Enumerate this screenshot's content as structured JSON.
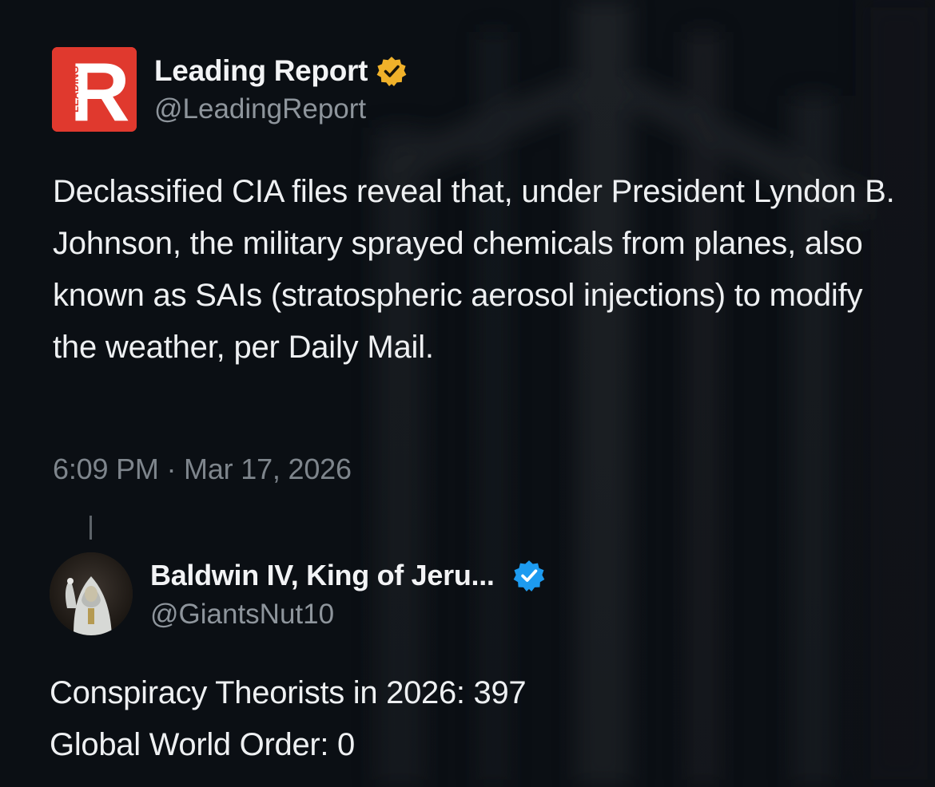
{
  "background": {
    "color": "#0b0f14",
    "description_icon": "blurred-architecture-photo-icon"
  },
  "post": {
    "author": {
      "display_name": "Leading Report",
      "handle": "@LeadingReport",
      "verified_badge": "gold-verified-badge-icon",
      "badge_color": "#f0b12a",
      "avatar": {
        "icon": "leading-report-logo-icon",
        "letter": "R",
        "side_text": "LEADING",
        "color": "#e0392e"
      }
    },
    "text": "Declassified CIA files reveal that, under President Lyndon B. Johnson, the military sprayed chemicals from planes, also known as SAIs (stratospheric aerosol injections) to modify the weather, per Daily Mail.",
    "timestamp": "6:09 PM · Mar 17, 2026"
  },
  "reply": {
    "author": {
      "display_name": "Baldwin IV, King of Jeru...",
      "handle": "@GiantsNut10",
      "verified_badge": "blue-verified-badge-icon",
      "badge_color": "#1d9bf0",
      "avatar_icon": "masked-king-avatar-icon"
    },
    "lines": [
      "Conspiracy Theorists in 2026: 397",
      "Global World Order: 0"
    ]
  }
}
